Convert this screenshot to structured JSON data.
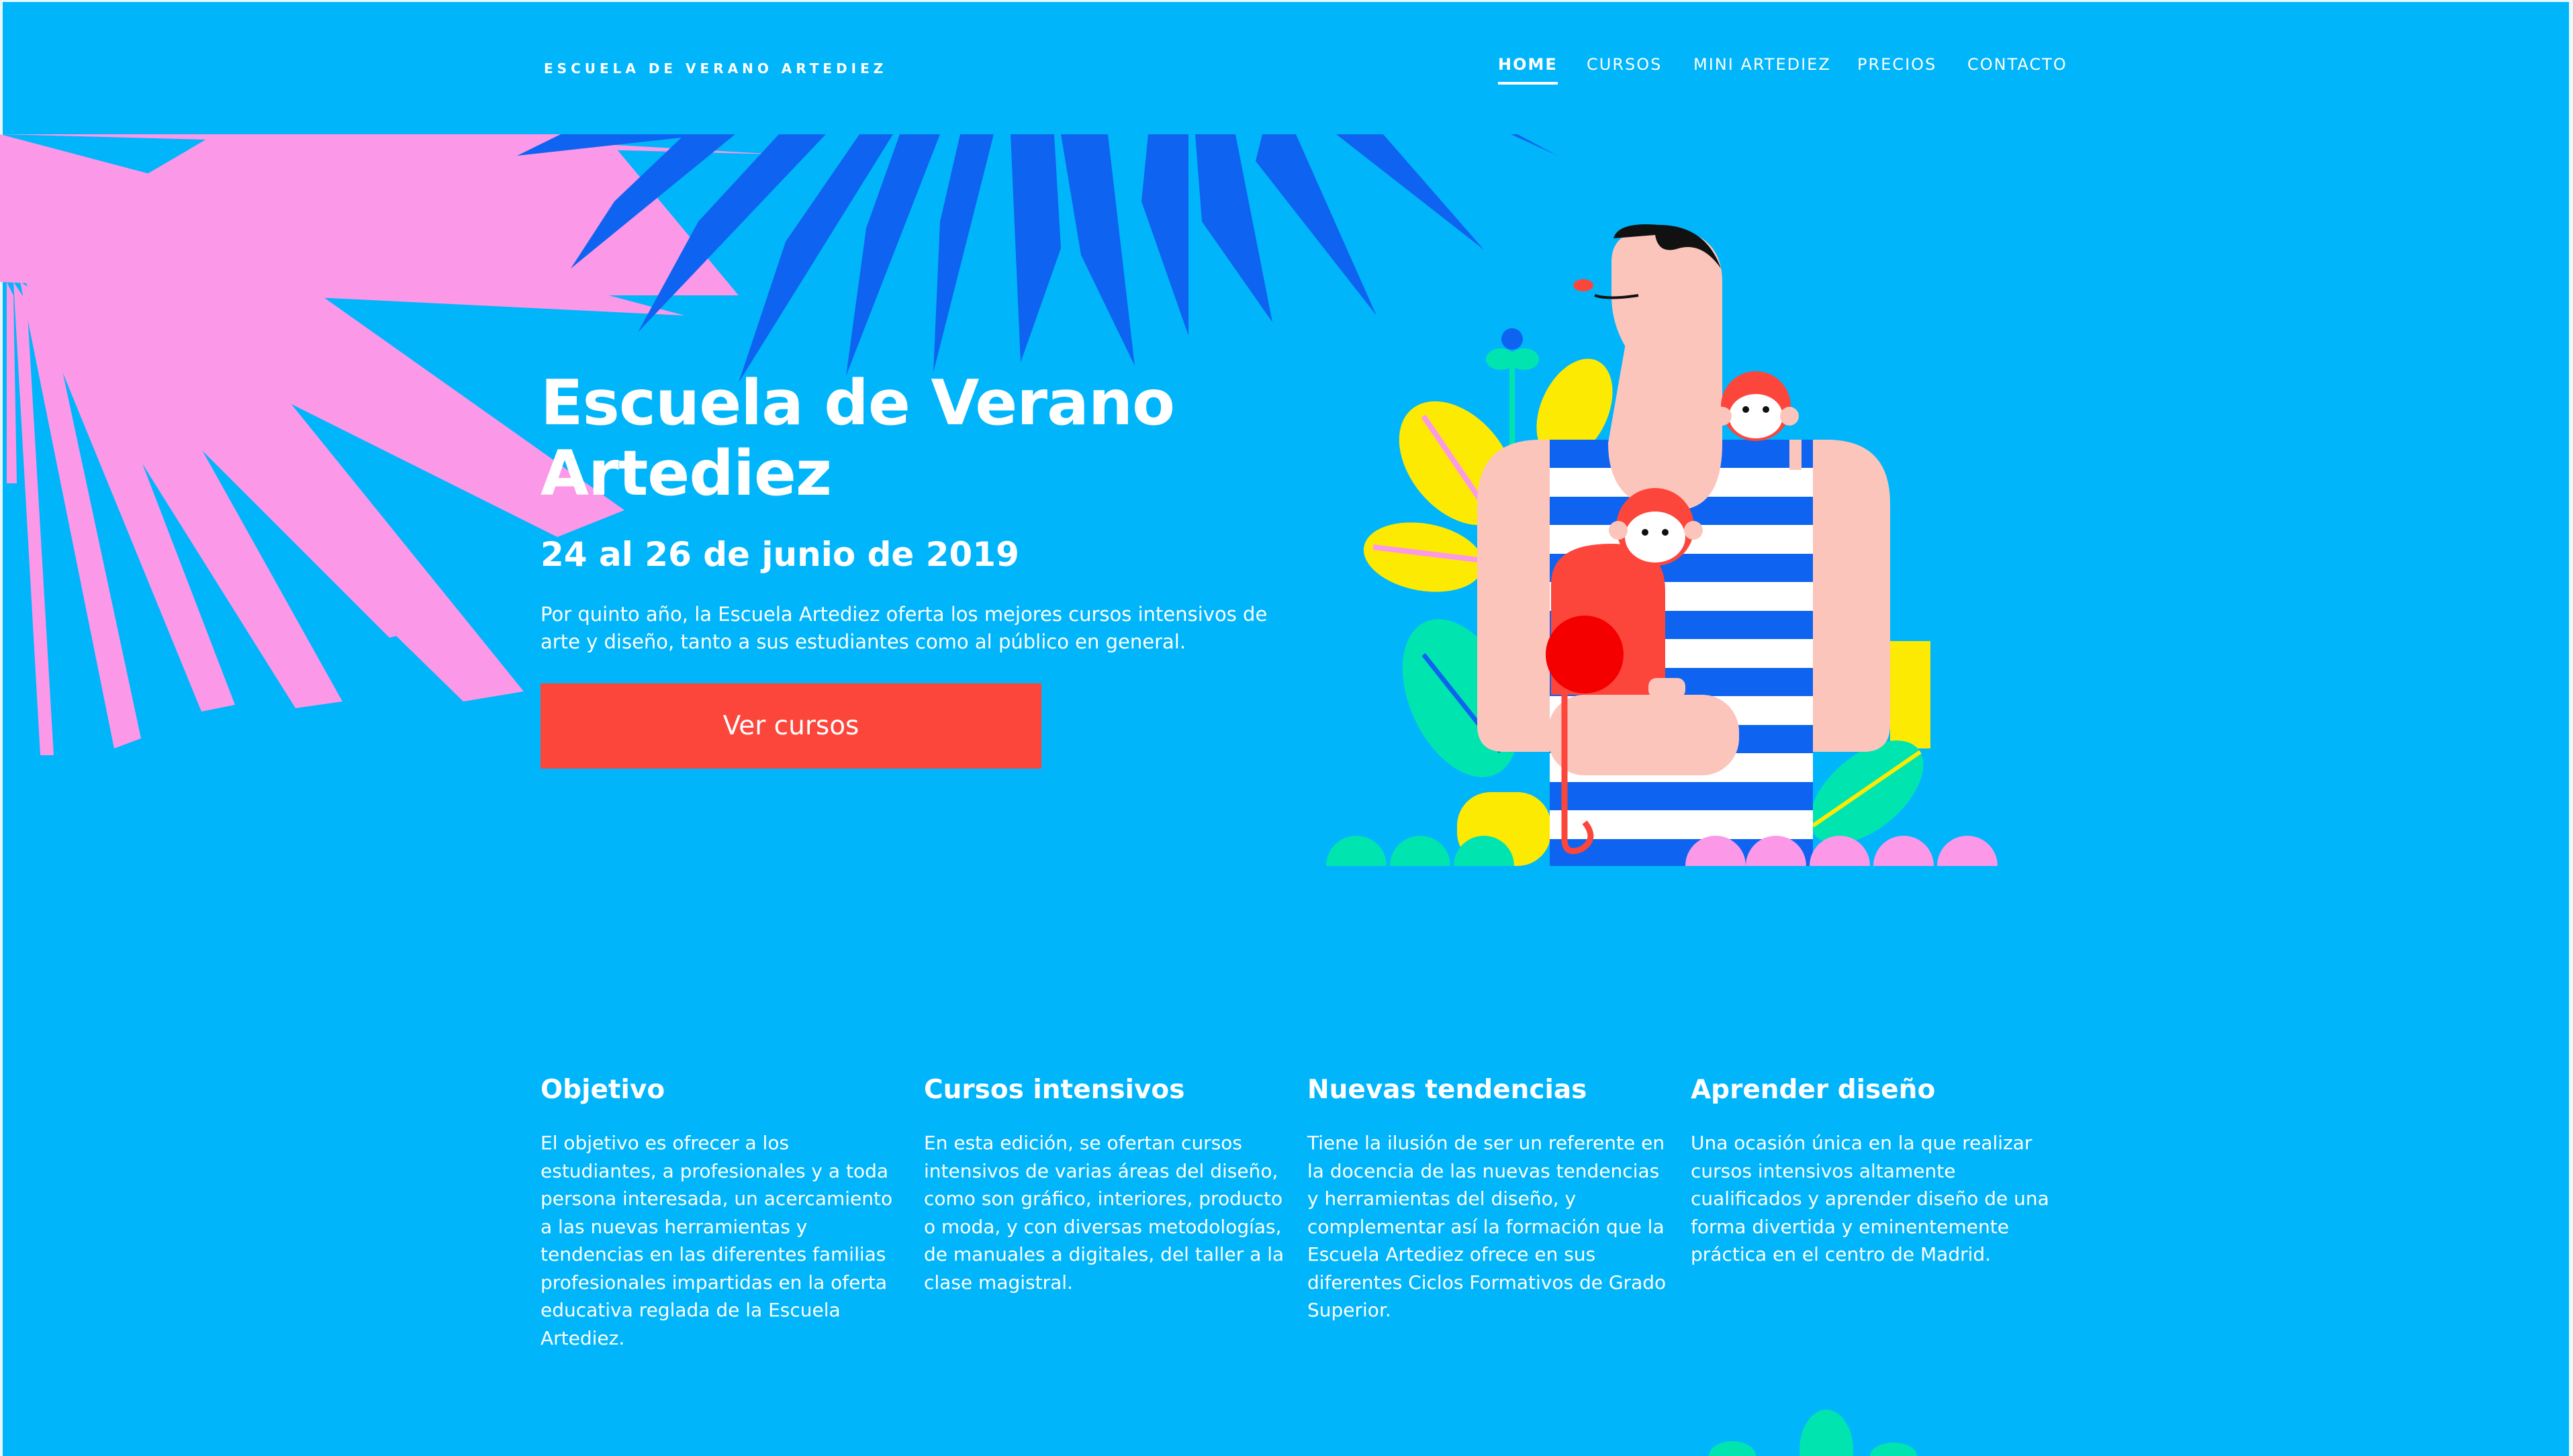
{
  "header": {
    "brand": "ESCUELA DE VERANO ARTEDIEZ",
    "nav": [
      {
        "label": "HOME",
        "active": true
      },
      {
        "label": "CURSOS",
        "active": false
      },
      {
        "label": "MINI ARTEDIEZ",
        "active": false
      },
      {
        "label": "PRECIOS",
        "active": false
      },
      {
        "label": "CONTACTO",
        "active": false
      }
    ]
  },
  "hero": {
    "title": "Escuela de Verano Artediez",
    "date": "24 al 26 de junio de 2019",
    "intro": "Por quinto año, la Escuela Artediez oferta los mejores cursos intensivos de arte y diseño, tanto a sus estudiantes como al público en general.",
    "cta_label": "Ver cursos"
  },
  "features": [
    {
      "title": "Objetivo",
      "text": "El objetivo es ofrecer a los estudiantes, a profesionales y a toda persona interesada, un acercamiento a las nuevas herramientas y tendencias en las diferentes familias profesionales impartidas en la oferta educativa reglada de la Escuela Artediez."
    },
    {
      "title": "Cursos intensivos",
      "text": "En esta edición, se ofertan cursos intensivos de varias áreas del diseño, como son gráfico, interiores, producto o moda, y con diversas metodologías, de manuales a digitales, del taller a la clase magistral."
    },
    {
      "title": "Nuevas tendencias",
      "text": "Tiene la ilusión de ser un referente en la docencia de las nuevas tendencias y herramientas del diseño, y complementar así la formación que la Escuela Artediez ofrece en sus diferentes Ciclos Formativos de Grado Superior."
    },
    {
      "title": "Aprender diseño",
      "text": "Una ocasión única en la que realizar cursos intensivos altamente cualificados y aprender diseño de una forma divertida y eminentemente práctica en el centro de Madrid."
    }
  ],
  "colors": {
    "background": "#01b5fb",
    "cta": "#fd463b",
    "palm_pink": "#fb98e8",
    "palm_blue": "#0e64f0"
  },
  "icons": {
    "hero_illustration": "man-with-monkeys-illustration",
    "palm_left": "pink-palm-leaf-icon",
    "palm_top": "blue-palm-leaf-icon"
  }
}
